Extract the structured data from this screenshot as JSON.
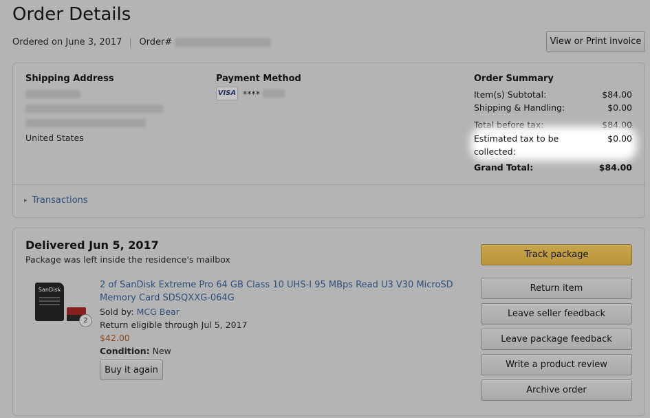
{
  "header": {
    "title": "Order Details",
    "ordered_on": "Ordered on June 3, 2017",
    "order_label": "Order#",
    "invoice_button": "View or Print invoice"
  },
  "shipping": {
    "heading": "Shipping Address",
    "country": "United States"
  },
  "payment": {
    "heading": "Payment Method",
    "card_brand": "VISA",
    "card_mask": "****"
  },
  "summary": {
    "heading": "Order Summary",
    "rows": [
      {
        "label": "Item(s) Subtotal:",
        "value": "$84.00"
      },
      {
        "label": "Shipping & Handling:",
        "value": "$0.00"
      },
      {
        "label": "Total before tax:",
        "value": "$84.00"
      },
      {
        "label": "Estimated tax to be collected:",
        "value": "$0.00"
      }
    ],
    "grand_label": "Grand Total:",
    "grand_value": "$84.00"
  },
  "transactions": {
    "arrow": "▸",
    "label": "Transactions"
  },
  "shipment": {
    "status": "Delivered Jun 5, 2017",
    "note": "Package was left inside the residence's mailbox",
    "item": {
      "title": "2 of SanDisk Extreme Pro 64 GB Class 10 UHS-I 95 MBps Read U3 V30 MicroSD Memory Card SDSQXXG-064G",
      "sold_by_label": "Sold by:",
      "seller": "MCG Bear",
      "return_text": "Return eligible through Jul 5, 2017",
      "price": "$42.00",
      "condition_label": "Condition:",
      "condition": "New",
      "quantity_badge": "2",
      "brand_text": "SanDisk",
      "buy_again": "Buy it again"
    },
    "actions": [
      "Track package",
      "Return item",
      "Leave seller feedback",
      "Leave package feedback",
      "Write a product review",
      "Archive order"
    ]
  },
  "colors": {
    "link": "#2d4f7a",
    "price": "#8a4a1e",
    "primary_button": "#c8a64c"
  }
}
